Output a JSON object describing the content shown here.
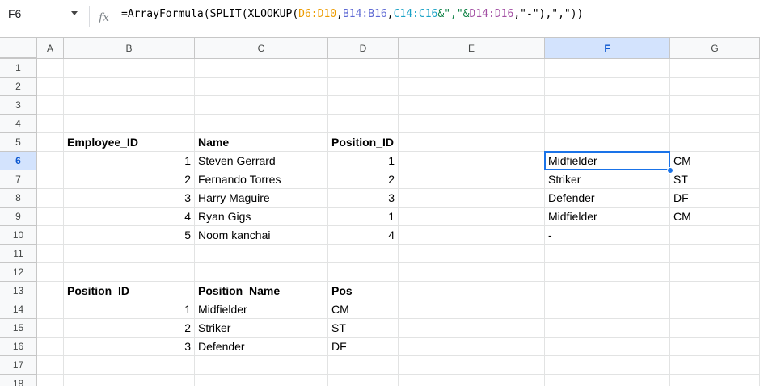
{
  "namebox": "F6",
  "formula": {
    "p1": "=ArrayFormula(SPLIT(XLOOKUP(",
    "r1": "D6:D10",
    "c1": ",",
    "r2": "B14:B16",
    "c2": ",",
    "r3": "C14:C16",
    "p2": "&\",\"&",
    "r4": "D14:D16",
    "p3": ",\"-\"),\",\"))"
  },
  "columns": [
    "A",
    "B",
    "C",
    "D",
    "E",
    "F",
    "G"
  ],
  "rows": [
    "1",
    "2",
    "3",
    "4",
    "5",
    "6",
    "7",
    "8",
    "9",
    "10",
    "11",
    "12",
    "13",
    "14",
    "15",
    "16",
    "17",
    "18"
  ],
  "cells": {
    "B5": "Employee_ID",
    "C5": "Name",
    "D5": "Position_ID",
    "B6": "1",
    "C6": "Steven Gerrard",
    "D6": "1",
    "F6": "Midfielder",
    "G6": "CM",
    "B7": "2",
    "C7": "Fernando Torres",
    "D7": "2",
    "F7": "Striker",
    "G7": "ST",
    "B8": "3",
    "C8": "Harry Maguire",
    "D8": "3",
    "F8": "Defender",
    "G8": "DF",
    "B9": "4",
    "C9": "Ryan Gigs",
    "D9": "1",
    "F9": "Midfielder",
    "G9": "CM",
    "B10": "5",
    "C10": "Noom kanchai",
    "D10": "4",
    "F10": "-",
    "B13": "Position_ID",
    "C13": "Position_Name",
    "D13": "Pos",
    "B14": "1",
    "C14": "Midfielder",
    "D14": "CM",
    "B15": "2",
    "C15": "Striker",
    "D15": "ST",
    "B16": "3",
    "C16": "Defender",
    "D16": "DF"
  },
  "selected_cell": "F6",
  "colors": {
    "selection": "#1a73e8",
    "header_selected": "#d3e3fd"
  }
}
